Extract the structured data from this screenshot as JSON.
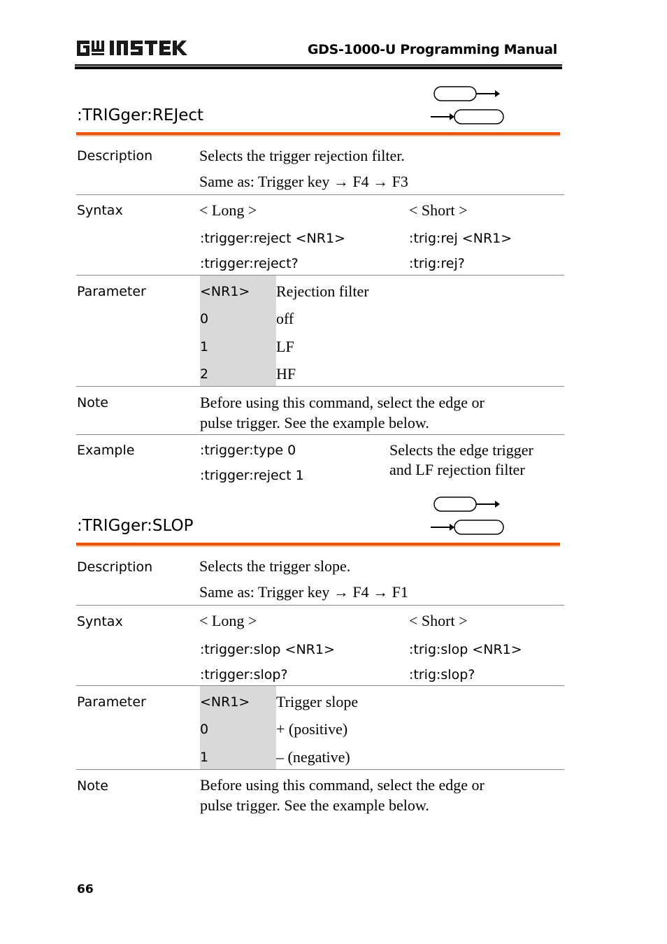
{
  "header": {
    "brand": "GW INSTEK",
    "manual_title": "GDS-1000-U Programming Manual"
  },
  "sections": [
    {
      "title": ":TRIGger:REJect",
      "icon": "set-query-icon",
      "description": {
        "label": "Description",
        "lines": [
          "Selects the trigger rejection filter.",
          "Same as: Trigger key → F4 → F3"
        ]
      },
      "syntax": {
        "label": "Syntax",
        "long_header": "< Long >",
        "short_header": "< Short >",
        "long": [
          ":trigger:reject <NR1>",
          ":trigger:reject?"
        ],
        "short": [
          ":trig:rej <NR1>",
          ":trig:rej?"
        ]
      },
      "parameter": {
        "label": "Parameter",
        "header": {
          "key": "<NR1>",
          "value": "Rejection filter"
        },
        "rows": [
          {
            "key": "0",
            "value": "off"
          },
          {
            "key": "1",
            "value": "LF"
          },
          {
            "key": "2",
            "value": "HF"
          }
        ]
      },
      "note": {
        "label": "Note",
        "lines": [
          "Before using this command, select the edge or",
          "pulse trigger. See the example below."
        ]
      },
      "example": {
        "label": "Example",
        "commands": [
          ":trigger:type 0",
          ":trigger:reject 1"
        ],
        "comment": [
          "Selects the edge trigger",
          "and LF rejection filter"
        ]
      }
    },
    {
      "title": ":TRIGger:SLOP",
      "icon": "set-query-icon",
      "description": {
        "label": "Description",
        "lines": [
          "Selects the trigger slope.",
          "Same as: Trigger key → F4 → F1"
        ]
      },
      "syntax": {
        "label": "Syntax",
        "long_header": "< Long >",
        "short_header": "< Short >",
        "long": [
          ":trigger:slop <NR1>",
          ":trigger:slop?"
        ],
        "short": [
          ":trig:slop <NR1>",
          ":trig:slop?"
        ]
      },
      "parameter": {
        "label": "Parameter",
        "header": {
          "key": "<NR1>",
          "value": "Trigger slope"
        },
        "rows": [
          {
            "key": "0",
            "value": "+ (positive)"
          },
          {
            "key": "1",
            "value": "– (negative)"
          }
        ]
      },
      "note": {
        "label": "Note",
        "lines": [
          "Before using this command, select the edge or",
          "pulse trigger. See the example below."
        ]
      }
    }
  ],
  "footer": {
    "page_number": "66"
  }
}
